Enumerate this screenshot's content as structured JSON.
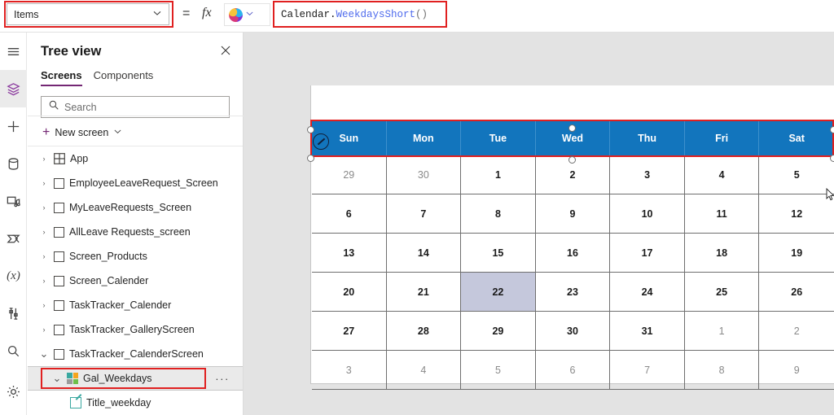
{
  "formula_bar": {
    "property_dropdown": {
      "value": "Items",
      "chevron_icon": "chevron-down-icon"
    },
    "equals": "=",
    "fx": "fx",
    "copilot_icon": "copilot-icon",
    "copilot_chevron": "chevron-down-icon",
    "formula": {
      "object": "Calendar.",
      "function": "WeekdaysShort",
      "parens": "()"
    },
    "accent_red": "#e02020"
  },
  "rail": {
    "items": [
      {
        "name": "menu-icon",
        "label": "Menu",
        "active": false
      },
      {
        "name": "tree-view-icon",
        "label": "Tree view",
        "active": true
      },
      {
        "name": "insert-icon",
        "label": "Insert",
        "active": false
      },
      {
        "name": "data-icon",
        "label": "Data",
        "active": false
      },
      {
        "name": "media-icon",
        "label": "Media",
        "active": false
      },
      {
        "name": "power-automate-icon",
        "label": "Power Automate",
        "active": false
      },
      {
        "name": "variables-icon",
        "label": "Variables",
        "active": false
      },
      {
        "name": "tools-icon",
        "label": "Tools",
        "active": false
      },
      {
        "name": "search-icon",
        "label": "Search",
        "active": false
      },
      {
        "name": "settings-icon",
        "label": "Settings",
        "active": false
      }
    ]
  },
  "tree": {
    "title": "Tree view",
    "close_icon": "close-icon",
    "tabs": [
      {
        "label": "Screens",
        "active": true
      },
      {
        "label": "Components",
        "active": false
      }
    ],
    "search": {
      "placeholder": "Search",
      "icon": "search-icon"
    },
    "new_screen": {
      "label": "New screen",
      "plus_icon": "plus-icon",
      "chevron_icon": "chevron-down-icon"
    },
    "nodes": [
      {
        "label": "App",
        "caret": "›",
        "icon": "app-icon",
        "indent": 0,
        "selected": false
      },
      {
        "label": "EmployeeLeaveRequest_Screen",
        "caret": "›",
        "icon": "screen-icon",
        "indent": 0,
        "selected": false
      },
      {
        "label": "MyLeaveRequests_Screen",
        "caret": "›",
        "icon": "screen-icon",
        "indent": 0,
        "selected": false
      },
      {
        "label": "AllLeave Requests_screen",
        "caret": "›",
        "icon": "screen-icon",
        "indent": 0,
        "selected": false
      },
      {
        "label": "Screen_Products",
        "caret": "›",
        "icon": "screen-icon",
        "indent": 0,
        "selected": false
      },
      {
        "label": "Screen_Calender",
        "caret": "›",
        "icon": "screen-icon",
        "indent": 0,
        "selected": false
      },
      {
        "label": "TaskTracker_Calender",
        "caret": "›",
        "icon": "screen-icon",
        "indent": 0,
        "selected": false
      },
      {
        "label": "TaskTracker_GalleryScreen",
        "caret": "›",
        "icon": "screen-icon",
        "indent": 0,
        "selected": false
      },
      {
        "label": "TaskTracker_CalenderScreen",
        "caret": "⌄",
        "icon": "screen-icon",
        "indent": 0,
        "selected": false
      },
      {
        "label": "Gal_Weekdays",
        "caret": "⌄",
        "icon": "gallery-icon",
        "indent": 1,
        "selected": true,
        "ellipsis": "···"
      },
      {
        "label": "Title_weekday",
        "caret": "",
        "icon": "label-icon",
        "indent": 2,
        "selected": false
      }
    ]
  },
  "calendar": {
    "header": [
      "Sun",
      "Mon",
      "Tue",
      "Wed",
      "Thu",
      "Fri",
      "Sat"
    ],
    "header_bg": "#1275bd",
    "selected_bg": "#c5c8dc",
    "weeks": [
      [
        {
          "d": "29",
          "muted": true
        },
        {
          "d": "30",
          "muted": true
        },
        {
          "d": "1",
          "muted": false
        },
        {
          "d": "2",
          "muted": false
        },
        {
          "d": "3",
          "muted": false
        },
        {
          "d": "4",
          "muted": false
        },
        {
          "d": "5",
          "muted": false
        }
      ],
      [
        {
          "d": "6",
          "muted": false
        },
        {
          "d": "7",
          "muted": false
        },
        {
          "d": "8",
          "muted": false
        },
        {
          "d": "9",
          "muted": false
        },
        {
          "d": "10",
          "muted": false
        },
        {
          "d": "11",
          "muted": false
        },
        {
          "d": "12",
          "muted": false
        }
      ],
      [
        {
          "d": "13",
          "muted": false
        },
        {
          "d": "14",
          "muted": false
        },
        {
          "d": "15",
          "muted": false
        },
        {
          "d": "16",
          "muted": false
        },
        {
          "d": "17",
          "muted": false
        },
        {
          "d": "18",
          "muted": false
        },
        {
          "d": "19",
          "muted": false
        }
      ],
      [
        {
          "d": "20",
          "muted": false
        },
        {
          "d": "21",
          "muted": false
        },
        {
          "d": "22",
          "muted": false,
          "selected": true
        },
        {
          "d": "23",
          "muted": false
        },
        {
          "d": "24",
          "muted": false
        },
        {
          "d": "25",
          "muted": false
        },
        {
          "d": "26",
          "muted": false
        }
      ],
      [
        {
          "d": "27",
          "muted": false
        },
        {
          "d": "28",
          "muted": false
        },
        {
          "d": "29",
          "muted": false
        },
        {
          "d": "30",
          "muted": false
        },
        {
          "d": "31",
          "muted": false
        },
        {
          "d": "1",
          "muted": true
        },
        {
          "d": "2",
          "muted": true
        }
      ],
      [
        {
          "d": "3",
          "muted": true
        },
        {
          "d": "4",
          "muted": true
        },
        {
          "d": "5",
          "muted": true
        },
        {
          "d": "6",
          "muted": true
        },
        {
          "d": "7",
          "muted": true
        },
        {
          "d": "8",
          "muted": true
        },
        {
          "d": "9",
          "muted": true
        }
      ]
    ]
  },
  "selection": {
    "edit_badge_icon": "edit-pencil-icon",
    "cursor_icon": "mouse-cursor-icon"
  }
}
